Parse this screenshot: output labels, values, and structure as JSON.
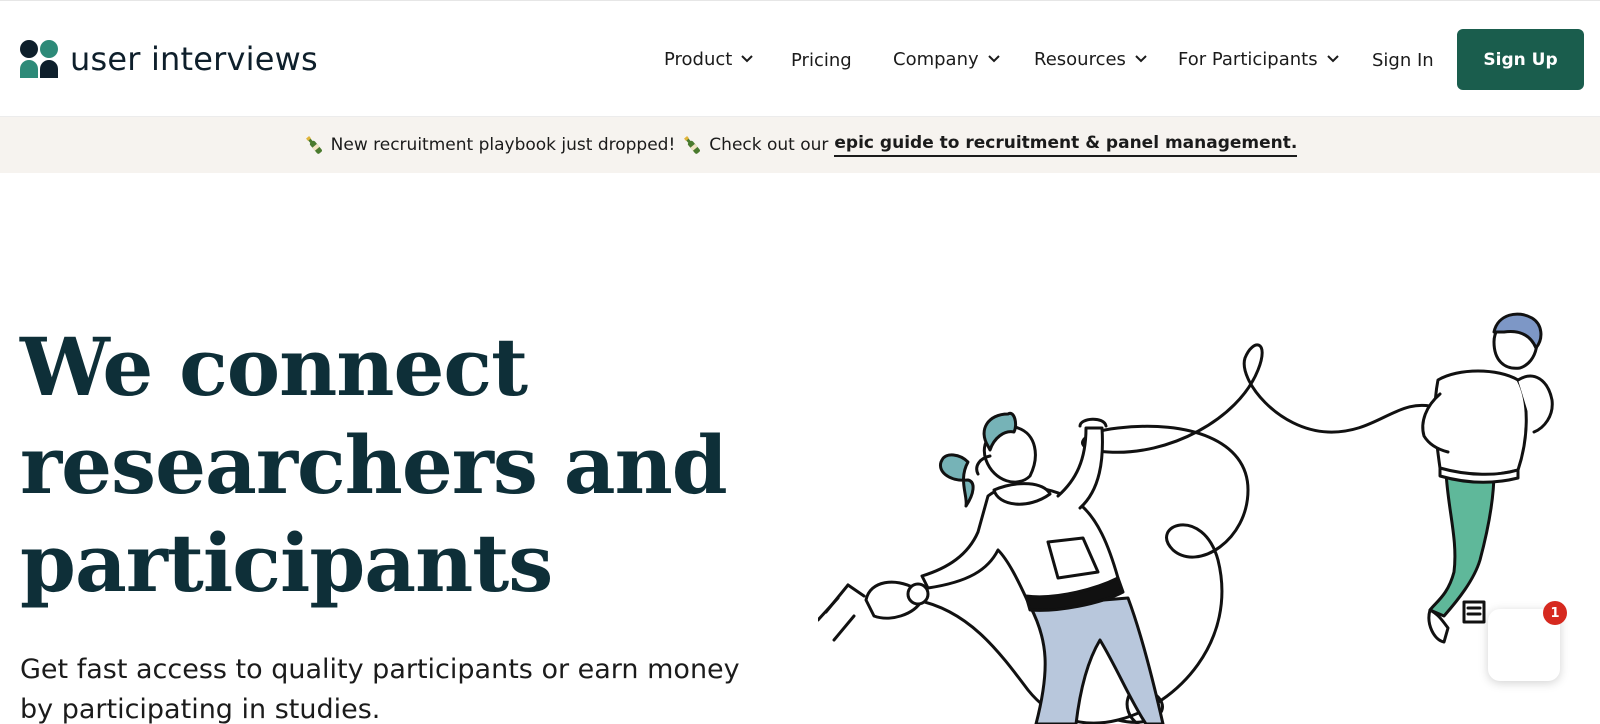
{
  "brand": {
    "name": "user interviews",
    "colors": {
      "accent": "#1a5d4d",
      "teal": "#2d8a78",
      "navy": "#0e1f2b",
      "heading": "#0e2f38",
      "banner_bg": "#f6f3ef",
      "badge": "#d6291f"
    }
  },
  "nav": {
    "items": [
      {
        "label": "Product",
        "dropdown": true
      },
      {
        "label": "Pricing",
        "dropdown": false
      },
      {
        "label": "Company",
        "dropdown": true
      },
      {
        "label": "Resources",
        "dropdown": true
      },
      {
        "label": "For Participants",
        "dropdown": true
      }
    ],
    "sign_in": "Sign In",
    "sign_up": "Sign Up"
  },
  "banner": {
    "icon": "champagne-bottle-icon",
    "text_1": "New recruitment playbook just dropped!",
    "text_2": "Check out our",
    "link": "epic guide to recruitment & panel management."
  },
  "hero": {
    "title_lines": [
      "We connect",
      "researchers and",
      "participants"
    ],
    "subtitle_lines": [
      "Get fast access to quality participants or earn money",
      "by participating in studies."
    ]
  },
  "chat": {
    "icon": "chat-icon",
    "badge": "1"
  }
}
